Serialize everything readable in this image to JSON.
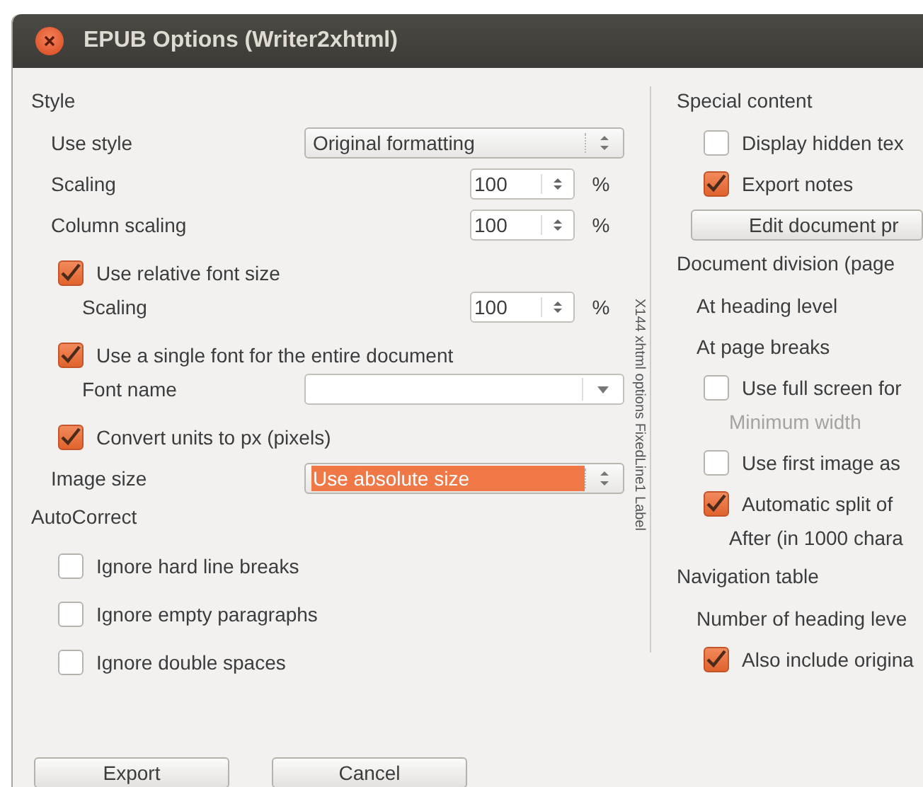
{
  "window": {
    "title": "EPUB Options (Writer2xhtml)"
  },
  "left": {
    "sections": [
      {
        "heading": "Style",
        "items": [
          {
            "kind": "select",
            "label": "Use style",
            "value": "Original formatting",
            "highlighted": false
          },
          {
            "kind": "spin",
            "label": "Scaling",
            "value": "100",
            "unit": "%"
          },
          {
            "kind": "spin",
            "label": "Column scaling",
            "value": "100",
            "unit": "%"
          },
          {
            "kind": "checkbox",
            "label": "Use relative font size",
            "checked": true,
            "children": [
              {
                "kind": "spin",
                "label": "Scaling",
                "value": "100",
                "unit": "%"
              }
            ]
          },
          {
            "kind": "checkbox",
            "label": "Use a single font for the entire document",
            "checked": true,
            "children": [
              {
                "kind": "combo",
                "label": "Font name"
              }
            ]
          },
          {
            "kind": "checkbox",
            "label": "Convert units to px (pixels)",
            "checked": true
          },
          {
            "kind": "select",
            "label": "Image size",
            "value": "Use absolute size",
            "highlighted": true
          }
        ]
      },
      {
        "heading": "AutoCorrect",
        "items": [
          {
            "kind": "checkbox",
            "label": "Ignore hard line breaks",
            "checked": false
          },
          {
            "kind": "checkbox",
            "label": "Ignore empty paragraphs",
            "checked": false
          },
          {
            "kind": "checkbox",
            "label": "Ignore double spaces",
            "checked": false
          }
        ]
      }
    ]
  },
  "divider_label": "X144 xhtml options FixedLine1 Label",
  "right": {
    "sections": [
      {
        "heading": "Special content",
        "items": [
          {
            "kind": "checkbox",
            "label": "Display hidden tex",
            "checked": false
          },
          {
            "kind": "checkbox",
            "label": "Export notes",
            "checked": true
          },
          {
            "kind": "button",
            "label": "Edit document pr"
          }
        ]
      },
      {
        "heading": "Document division (page",
        "items": [
          {
            "kind": "text",
            "label": "At heading level"
          },
          {
            "kind": "text",
            "label": "At page breaks"
          },
          {
            "kind": "checkbox",
            "label": "Use full screen for",
            "checked": false,
            "children": [
              {
                "kind": "text",
                "label": "Minimum width",
                "disabled": true
              }
            ]
          },
          {
            "kind": "checkbox",
            "label": "Use first image as",
            "checked": false
          },
          {
            "kind": "checkbox",
            "label": "Automatic split of",
            "checked": true,
            "children": [
              {
                "kind": "text",
                "label": "After (in 1000 chara",
                "disabled": false
              }
            ]
          }
        ]
      },
      {
        "heading": "Navigation table",
        "items": [
          {
            "kind": "text",
            "label": "Number of heading leve"
          },
          {
            "kind": "checkbox",
            "label": "Also include origina",
            "checked": true
          }
        ]
      }
    ]
  },
  "buttons": [
    "Export",
    "Cancel"
  ]
}
